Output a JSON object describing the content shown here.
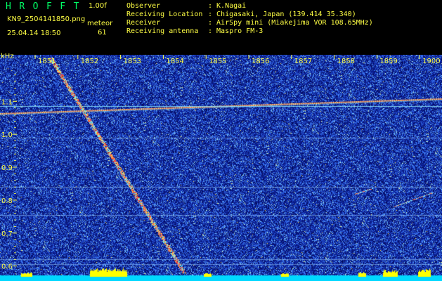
{
  "header": {
    "app_title": "HROFFT",
    "version": "1.00f",
    "filename": "KN9_2504141850.png",
    "date_time": "25.04.14 18:50",
    "meteor_label": "meteor",
    "meteor_count": "61"
  },
  "info": [
    {
      "label": "Observer",
      "value": ": K.Nagai"
    },
    {
      "label": "Receiving Location",
      "value": ": Chigasaki, Japan (139.414 35.340)"
    },
    {
      "label": "Receiver",
      "value": ": AirSpy mini (Miakejima VOR 108.65MHz)"
    },
    {
      "label": "Receiving antenna",
      "value": ": Maspro FM-3"
    }
  ],
  "chart_data": {
    "type": "heatmap",
    "x_unit": "time",
    "x_ticks": [
      "1851",
      "1852",
      "1853",
      "1854",
      "1855",
      "1856",
      "1857",
      "1858",
      "1859",
      "1900"
    ],
    "y_unit_label": "kHz",
    "y_ticks": [
      "1.1",
      "1.0",
      "0.9",
      "0.8",
      "0.7",
      "0.6"
    ],
    "ylim": [
      0.58,
      1.22
    ],
    "colors": {
      "background": "#0a1a8c",
      "noise": "#3a6cf0",
      "signal": "#ff4040",
      "axis_text": "#ffff44",
      "baseline": "#00d8ff",
      "peaks": "#ffff00"
    }
  }
}
